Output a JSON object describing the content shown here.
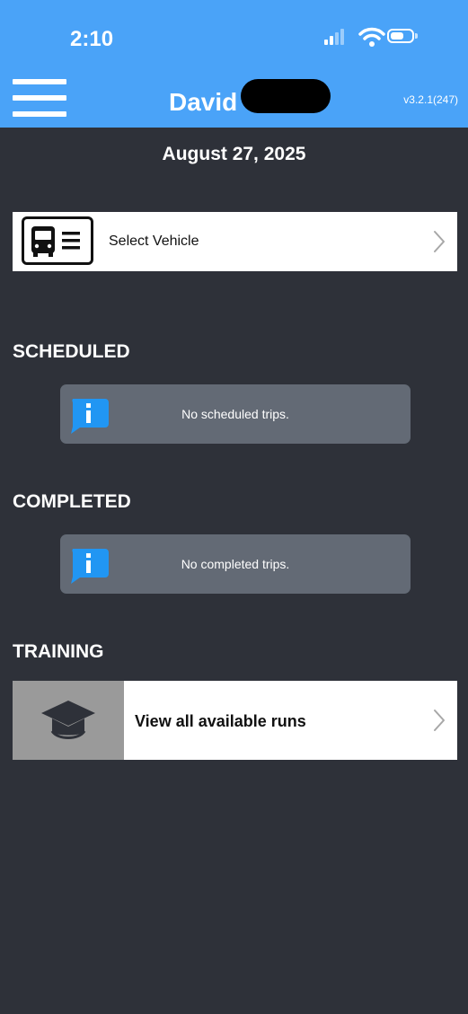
{
  "status_bar": {
    "time": "2:10",
    "icons": [
      "signal-icon",
      "wifi-icon",
      "battery-icon"
    ]
  },
  "header": {
    "menu_icon": "hamburger-menu-icon",
    "user_name": "David",
    "version": "v3.2.1(247)",
    "background_color": "#4aa3f8"
  },
  "date": "August 27, 2025",
  "vehicle": {
    "label": "Select Vehicle",
    "icon": "bus-card-icon",
    "chevron": "chevron-right-icon"
  },
  "sections": {
    "scheduled": {
      "title": "SCHEDULED",
      "message": "No scheduled trips.",
      "icon": "info-icon"
    },
    "completed": {
      "title": "COMPLETED",
      "message": "No completed trips.",
      "icon": "info-icon"
    },
    "training": {
      "title": "TRAINING",
      "runs_label": "View all available runs",
      "icon": "graduation-cap-icon",
      "chevron": "chevron-right-icon"
    }
  },
  "colors": {
    "background": "#2e3139",
    "info_box": "#636a75",
    "info_icon": "#2196f3"
  }
}
